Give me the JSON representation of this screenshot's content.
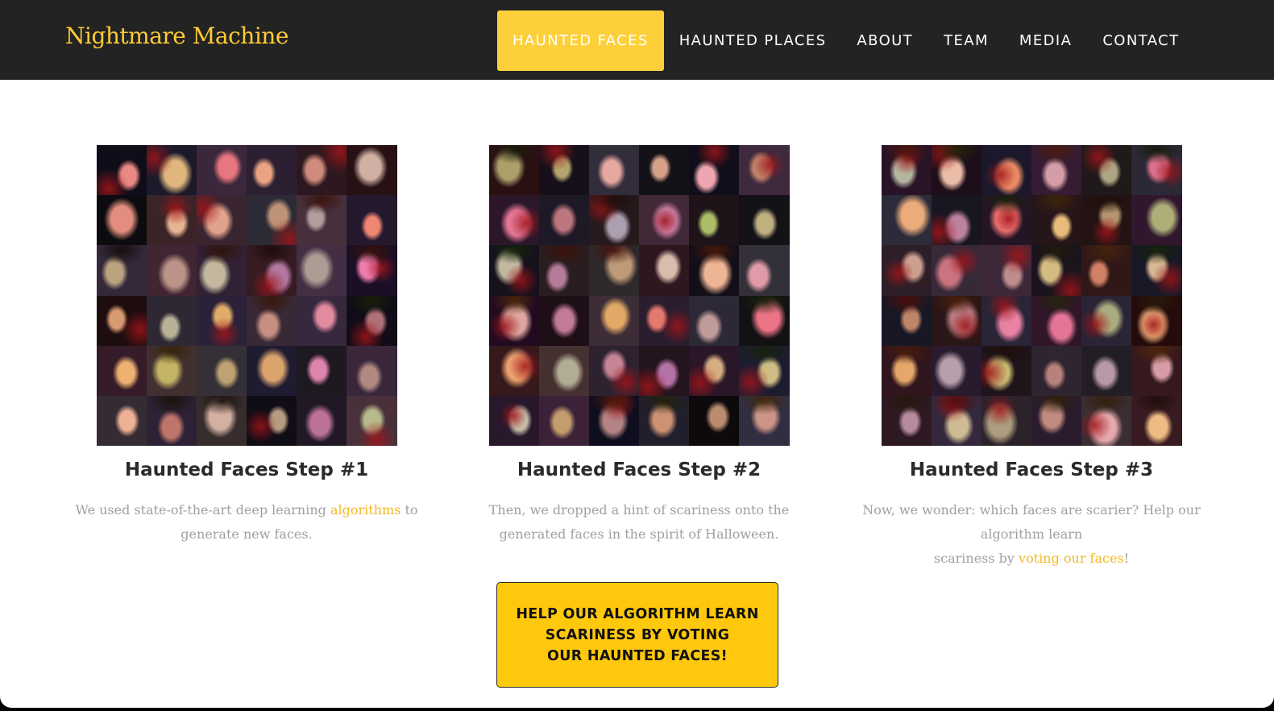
{
  "brand": "Nightmare Machine",
  "nav": [
    {
      "label": "HAUNTED FACES",
      "active": true
    },
    {
      "label": "HAUNTED PLACES",
      "active": false
    },
    {
      "label": "ABOUT",
      "active": false
    },
    {
      "label": "TEAM",
      "active": false
    },
    {
      "label": "MEDIA",
      "active": false
    },
    {
      "label": "CONTACT",
      "active": false
    }
  ],
  "steps": [
    {
      "title": "Haunted Faces Step #1",
      "text_before": "We used state-of-the-art deep learning ",
      "link": "algorithms",
      "text_after": " to generate new faces."
    },
    {
      "title": "Haunted Faces Step #2",
      "text": "Then, we dropped a hint of scariness onto the generated faces in the spirit of Halloween."
    },
    {
      "title": "Haunted Faces Step #3",
      "text_before": "Now, we wonder: which faces are scarier? Help our algorithm learn",
      "text_mid": "scariness by ",
      "link": "voting our faces",
      "text_after": "!"
    }
  ],
  "cta": {
    "line1": "HELP OUR ALGORITHM LEARN",
    "line2": "SCARINESS BY VOTING",
    "line3": "OUR HAUNTED FACES!"
  },
  "colors": {
    "nav_bg": "#232323",
    "accent": "#fdd03b",
    "brand": "#ffcc33",
    "link": "#f3b925",
    "cta_bg": "#fec80c"
  }
}
